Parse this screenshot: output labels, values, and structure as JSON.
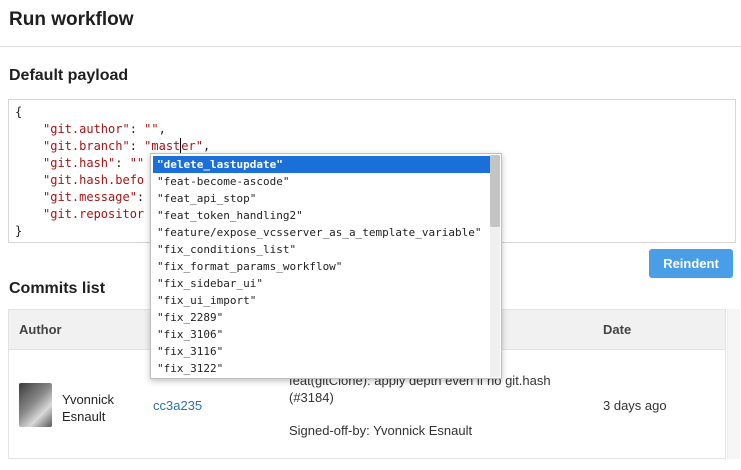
{
  "header": {
    "title": "Run workflow"
  },
  "payload": {
    "title": "Default payload",
    "lines": [
      {
        "text": "{"
      },
      {
        "key": "\"git.author\"",
        "sep": ": ",
        "value": "\"\"",
        "tail": ","
      },
      {
        "key": "\"git.branch\"",
        "sep": ": ",
        "value_before_cursor": "\"mast",
        "value_after_cursor": "er\"",
        "tail": ","
      },
      {
        "key": "\"git.hash\"",
        "sep": ": ",
        "value": "\"\"",
        "tail": ""
      },
      {
        "key": "\"git.hash.befo",
        "sep": "",
        "value": "",
        "tail": ""
      },
      {
        "key": "\"git.message\"",
        "sep": ":",
        "value": "",
        "tail": ""
      },
      {
        "key": "\"git.repositor",
        "sep": "",
        "value": "",
        "tail": ""
      },
      {
        "text": "}"
      }
    ],
    "reindent_label": "Reindent"
  },
  "autocomplete": {
    "items": [
      "\"delete_lastupdate\"",
      "\"feat-become-ascode\"",
      "\"feat_api_stop\"",
      "\"feat_token_handling2\"",
      "\"feature/expose_vcsserver_as_a_template_variable\"",
      "\"fix_conditions_list\"",
      "\"fix_format_params_workflow\"",
      "\"fix_sidebar_ui\"",
      "\"fix_ui_import\"",
      "\"fix_2289\"",
      "\"fix_3106\"",
      "\"fix_3116\"",
      "\"fix_3122\""
    ],
    "selected_index": 0
  },
  "commits": {
    "title": "Commits list",
    "columns": [
      "Author",
      "Date"
    ],
    "rows": [
      {
        "author_line1": "Yvonnick",
        "author_line2": "Esnault",
        "hash": "cc3a235",
        "message_line1": "feat(gitClone): apply depth even if no git.hash",
        "message_line2": "(#3184)",
        "message_line3": "Signed-off-by: Yvonnick Esnault",
        "date": "3 days ago"
      }
    ]
  }
}
